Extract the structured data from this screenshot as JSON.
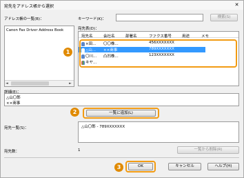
{
  "window": {
    "title": "宛先をアドレス帳から選択",
    "close_glyph": "✕"
  },
  "address_book": {
    "label": "アドレス帳の一覧(B)：",
    "items": [
      "Canon Fax Driver Address Book"
    ],
    "scroll_left": "◄",
    "scroll_right": "►"
  },
  "keyword": {
    "label": "キーワード(K)：",
    "value": "",
    "search_label": "検索(S)"
  },
  "destinations": {
    "label": "宛先表(D)：",
    "columns": [
      "宛先名",
      "会社名",
      "部署名",
      "ファクス番号",
      "用途",
      "メモ"
    ],
    "rows": [
      {
        "icon": "person-icon",
        "name": "×田...",
        "company": "〇〇株...",
        "dept": "",
        "fax": "456XXXXXXX",
        "selected": false
      },
      {
        "icon": "person-icon",
        "name": "△山...",
        "company": "××商事",
        "dept": "",
        "fax": "789XXXXXXX",
        "selected": true
      },
      {
        "icon": "person-icon",
        "name": "〇川...",
        "company": "凸凹株...",
        "dept": "",
        "fax": "123XXXXXXX",
        "selected": false
      },
      {
        "icon": "group-icon",
        "name": "キヤ...",
        "company": "",
        "dept": "",
        "fax": "",
        "selected": false
      }
    ]
  },
  "details": {
    "label": "詳細(E)：",
    "lines": [
      "△山〇郎",
      "××商事"
    ]
  },
  "add_button_label": "一覧に追加(L)",
  "list": {
    "label": "宛先一覧(S)：",
    "entries": [
      "△山〇郎 - 789XXXXXXX"
    ]
  },
  "count": {
    "label": "宛先数：",
    "value": "1"
  },
  "remove_button_label": "一覧から削除(R)",
  "footer": {
    "ok": "OK",
    "cancel": "キャンセル",
    "help": "ヘルプ(H)"
  },
  "callouts": [
    "1",
    "2",
    "3"
  ],
  "colors": {
    "accent": "#f29b12",
    "callout": "#e08a00",
    "selection": "#3399ff"
  }
}
